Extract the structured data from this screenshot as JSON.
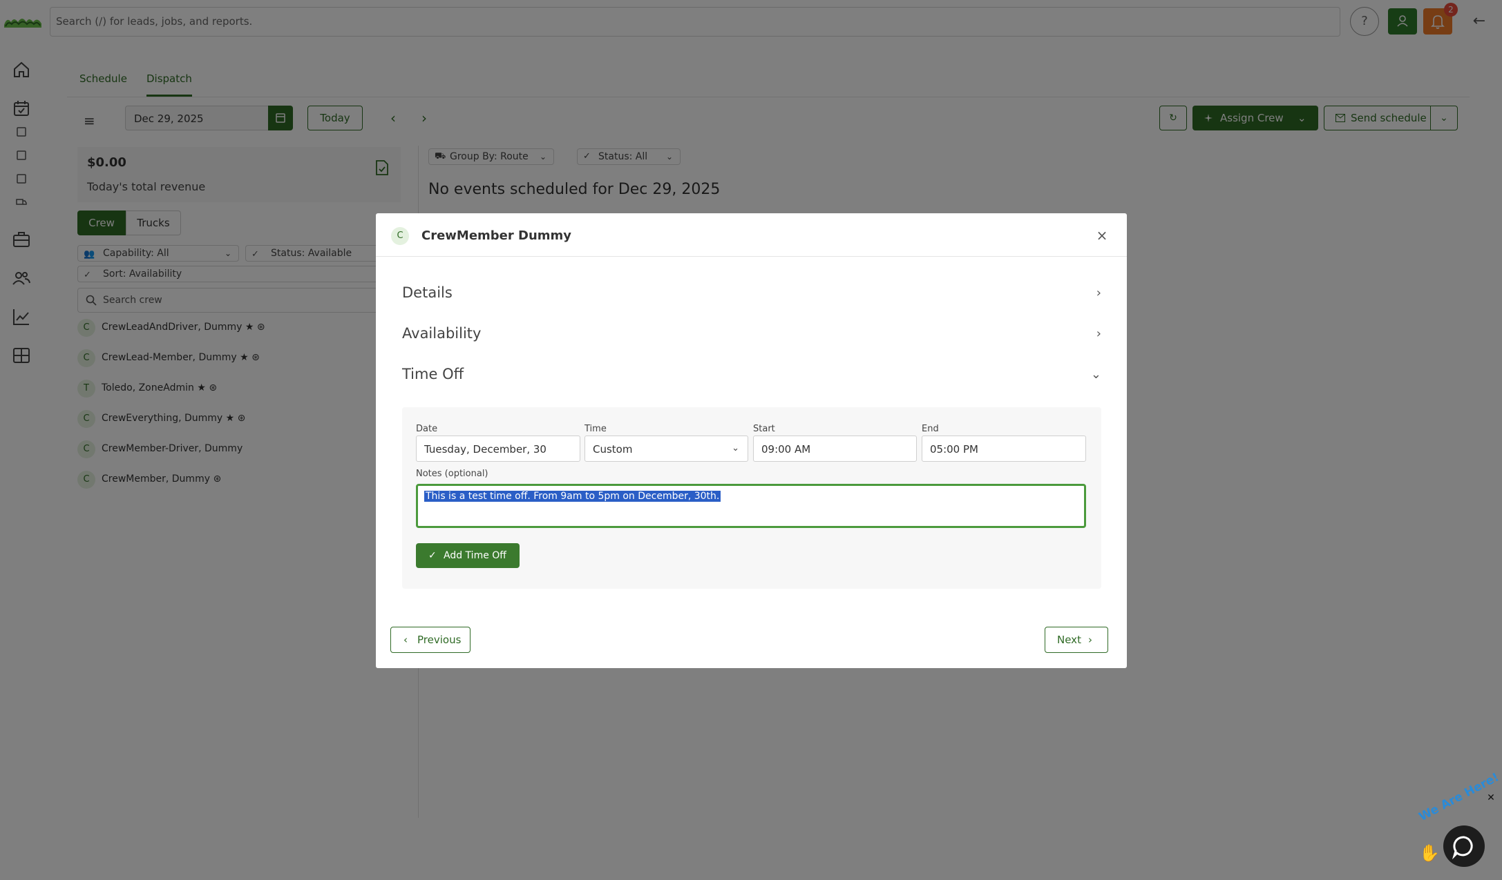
{
  "topbar": {
    "search_placeholder": "Search (/) for leads, jobs, and reports.",
    "help_label": "?",
    "notification_count": "2"
  },
  "tabs": [
    "Schedule",
    "Dispatch"
  ],
  "toolbar": {
    "date": "Dec 29, 2025",
    "today": "Today",
    "assign_crew": "Assign Crew",
    "send_schedule": "Send schedule"
  },
  "revenue": {
    "amount": "$0.00",
    "label": "Today's total revenue"
  },
  "segment": {
    "crew": "Crew",
    "trucks": "Trucks"
  },
  "filters": {
    "capability": "Capability: All",
    "status": "Status: Available",
    "sort": "Sort: Availability",
    "search_placeholder": "Search crew"
  },
  "crew": [
    {
      "initial": "C",
      "name": "CrewLeadAndDriver, Dummy"
    },
    {
      "initial": "C",
      "name": "CrewLead-Member, Dummy"
    },
    {
      "initial": "T",
      "name": "Toledo, ZoneAdmin"
    },
    {
      "initial": "C",
      "name": "CrewEverything, Dummy"
    },
    {
      "initial": "C",
      "name": "CrewMember-Driver, Dummy"
    },
    {
      "initial": "C",
      "name": "CrewMember, Dummy"
    }
  ],
  "events": {
    "group_by": "Group By: Route",
    "status": "Status: All",
    "empty": "No events scheduled for Dec 29, 2025"
  },
  "modal": {
    "initial": "C",
    "title": "CrewMember Dummy",
    "sections": [
      "Details",
      "Availability",
      "Time Off"
    ],
    "timeoff": {
      "date_label": "Date",
      "date_value": "Tuesday, December, 30",
      "time_label": "Time",
      "time_value": "Custom",
      "start_label": "Start",
      "start_value": "09:00 AM",
      "end_label": "End",
      "end_value": "05:00 PM",
      "notes_label": "Notes (optional)",
      "notes_value": "This is a test time off. From 9am to 5pm on December, 30th.",
      "add_button": "Add Time Off"
    },
    "previous": "Previous",
    "next": "Next"
  },
  "chat": {
    "text": "We Are Here!"
  },
  "colors": {
    "primary": "#2f6a25",
    "notification": "#ef7a29",
    "selection": "#2a5ec6"
  }
}
